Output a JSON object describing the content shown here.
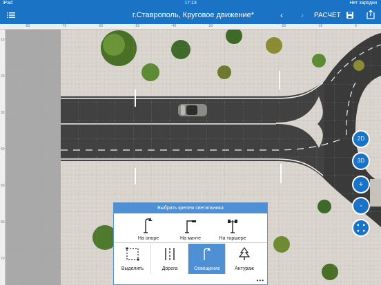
{
  "status_bar": {
    "device": "iPad",
    "time": "17:13",
    "battery": "Нет зарядки"
  },
  "nav": {
    "title": "г.Ставрополь, Круговое движение*",
    "calculate_label": "РАСЧЕТ"
  },
  "ruler": {
    "top": [
      "-80",
      "-70",
      "-60",
      "-50",
      "-40",
      "-30",
      "-20",
      "-10",
      "0"
    ],
    "left": [
      "10",
      "20",
      "30",
      "40",
      "50",
      "60",
      "70"
    ]
  },
  "view": {
    "btn_2d": "2D",
    "btn_3d": "3D",
    "zoom_in": "+",
    "zoom_out": "-"
  },
  "panel": {
    "header": "Выбрать крепеж светильника",
    "mounts": [
      {
        "label": "На опоре",
        "icon": "pole-lamp-icon"
      },
      {
        "label": "На мачте",
        "icon": "mast-lamp-icon"
      },
      {
        "label": "На торшере",
        "icon": "floor-lamp-icon"
      }
    ],
    "tabs": [
      {
        "label": "Выделить",
        "icon": "select-icon",
        "active": false
      },
      {
        "label": "Дорога",
        "icon": "road-icon",
        "active": false
      },
      {
        "label": "Освещение",
        "icon": "lighting-icon",
        "active": true
      },
      {
        "label": "Антураж",
        "icon": "tree-icon",
        "active": false
      }
    ],
    "more": "•••"
  },
  "colors": {
    "accent": "#1b73c6",
    "panel_accent": "#4f8fd3",
    "asphalt": "#3f3f3f",
    "paving": "#d8d4cc"
  }
}
